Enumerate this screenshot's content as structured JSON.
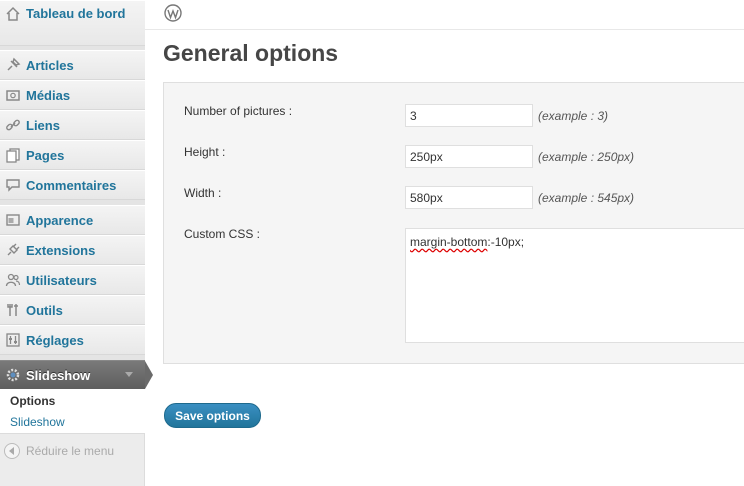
{
  "sidebar": {
    "items": [
      {
        "label": "Tableau de bord",
        "icon": "home-icon"
      },
      {
        "label": "Articles",
        "icon": "pushpin-icon"
      },
      {
        "label": "Médias",
        "icon": "media-icon"
      },
      {
        "label": "Liens",
        "icon": "link-icon"
      },
      {
        "label": "Pages",
        "icon": "pages-icon"
      },
      {
        "label": "Commentaires",
        "icon": "comment-icon"
      },
      {
        "label": "Apparence",
        "icon": "appearance-icon"
      },
      {
        "label": "Extensions",
        "icon": "plugin-icon"
      },
      {
        "label": "Utilisateurs",
        "icon": "users-icon"
      },
      {
        "label": "Outils",
        "icon": "tools-icon"
      },
      {
        "label": "Réglages",
        "icon": "settings-icon"
      },
      {
        "label": "Slideshow",
        "icon": "gear-icon"
      }
    ],
    "submenu": [
      "Options",
      "Slideshow"
    ],
    "collapse_label": "Réduire le menu"
  },
  "main": {
    "title": "General options",
    "fields": [
      {
        "label": "Number of pictures :",
        "value": "3",
        "example": "(example : 3)"
      },
      {
        "label": "Height :",
        "value": "250px",
        "example": "(example : 250px)"
      },
      {
        "label": "Width :",
        "value": "580px",
        "example": "(example : 545px)"
      }
    ],
    "custom_css": {
      "label": "Custom CSS :",
      "value_misspelled": "margin-bottom",
      "value_rest": ":-10px;"
    },
    "save_label": "Save options"
  },
  "colors": {
    "link": "#21759b",
    "active_menu": "#6a6a6a",
    "button": "#21759b"
  }
}
